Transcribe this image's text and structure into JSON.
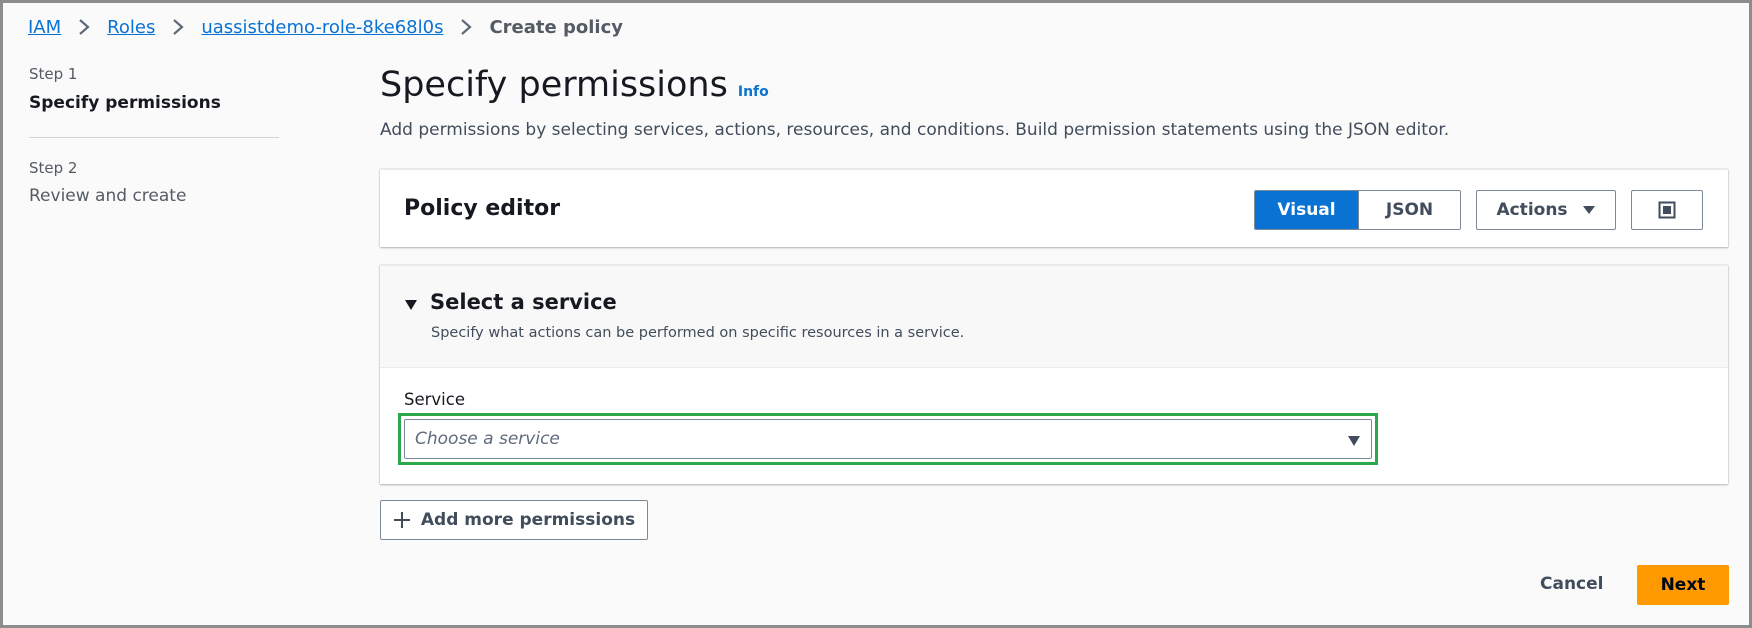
{
  "breadcrumb": {
    "items": [
      "IAM",
      "Roles",
      "uassistdemo-role-8ke68l0s"
    ],
    "current": "Create policy"
  },
  "sidenav": {
    "step1_num": "Step 1",
    "step1_title": "Specify permissions",
    "step2_num": "Step 2",
    "step2_title": "Review and create"
  },
  "header": {
    "title": "Specify permissions",
    "info": "Info",
    "description": "Add permissions by selecting services, actions, resources, and conditions. Build permission statements using the JSON editor."
  },
  "policy_editor": {
    "title": "Policy editor",
    "mode_visual": "Visual",
    "mode_json": "JSON",
    "selected_mode": "Visual",
    "actions_label": "Actions"
  },
  "select_service": {
    "title": "Select a service",
    "description": "Specify what actions can be performed on specific resources in a service.",
    "field_label": "Service",
    "placeholder": "Choose a service"
  },
  "add_more_label": "Add more permissions",
  "footer": {
    "cancel": "Cancel",
    "next": "Next"
  },
  "colors": {
    "link": "#0972d3",
    "primary": "#ff9900",
    "focus": "#2ba84a"
  }
}
